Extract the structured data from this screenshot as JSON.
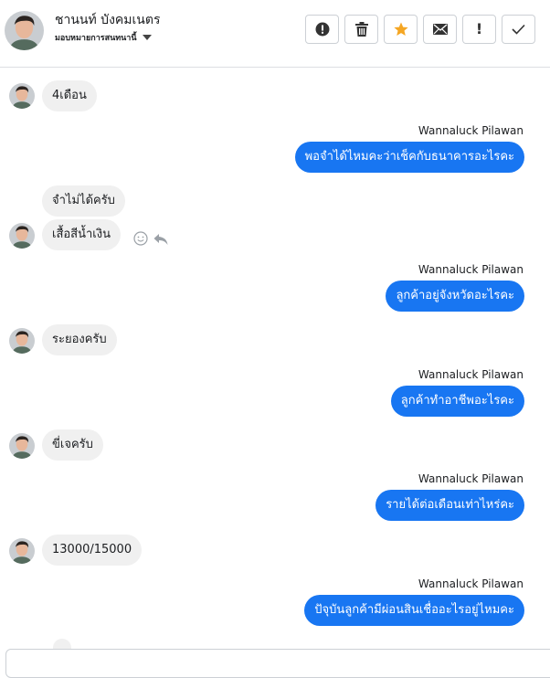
{
  "header": {
    "contact_name": "ชานนท์ บังคมเนตร",
    "assign_label": "มอบหมายการสนทนานี้",
    "actions": [
      {
        "name": "spam-button",
        "icon": "alert-circle-icon"
      },
      {
        "name": "delete-button",
        "icon": "trash-icon"
      },
      {
        "name": "star-button",
        "icon": "star-icon"
      },
      {
        "name": "mark-unread-button",
        "icon": "envelope-icon"
      },
      {
        "name": "follow-up-button",
        "icon": "exclamation-icon"
      },
      {
        "name": "done-button",
        "icon": "check-icon"
      }
    ]
  },
  "colors": {
    "outgoing_bubble": "#1876f2",
    "incoming_bubble": "#f0f0f0",
    "star": "#f5a623"
  },
  "messages": [
    {
      "direction": "in",
      "text": "4เดือน"
    },
    {
      "direction": "out",
      "sender": "Wannaluck Pilawan",
      "text": "พอจำได้ไหมคะว่าเช็คกับธนาคารอะไรคะ"
    },
    {
      "direction": "in",
      "text": "จำไม่ได้ครับ"
    },
    {
      "direction": "in",
      "text": "เสื้อสีน้ำเงิน"
    },
    {
      "direction": "out",
      "sender": "Wannaluck Pilawan",
      "text": "ลูกค้าอยู่จังหวัดอะไรคะ"
    },
    {
      "direction": "in",
      "text": "ระยองครับ"
    },
    {
      "direction": "out",
      "sender": "Wannaluck Pilawan",
      "text": "ลูกค้าทำอาชีพอะไรคะ"
    },
    {
      "direction": "in",
      "text": "ขี่เจครับ"
    },
    {
      "direction": "out",
      "sender": "Wannaluck Pilawan",
      "text": "รายได้ต่อเดือนเท่าไหร่คะ"
    },
    {
      "direction": "in",
      "text": "13000/15000"
    },
    {
      "direction": "out",
      "sender": "Wannaluck Pilawan",
      "text": "ปัจุบันลูกค้ามีผ่อนสินเชื่ออะไรอยู่ไหมคะ"
    }
  ],
  "message_tools": [
    "smiley-icon",
    "reply-icon"
  ]
}
